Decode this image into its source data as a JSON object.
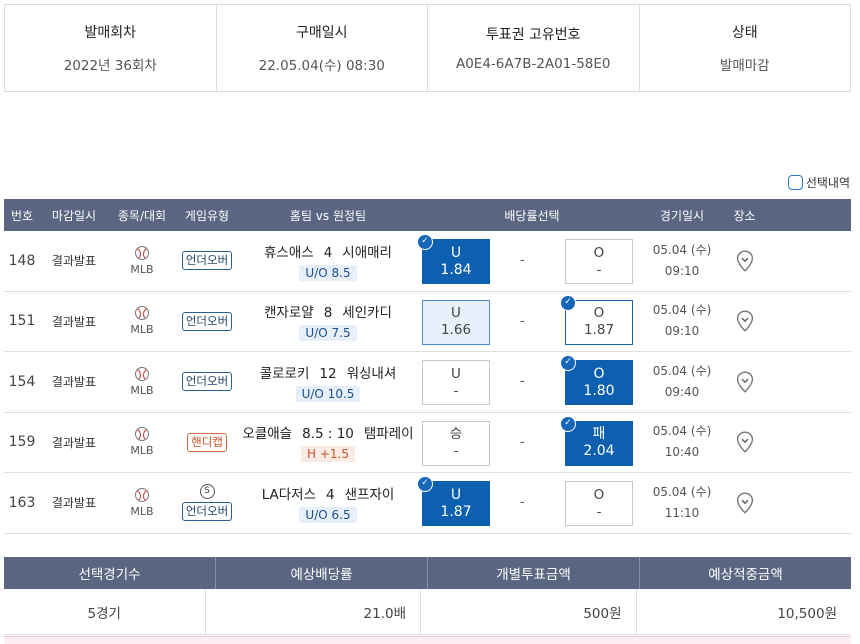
{
  "info": {
    "round_label": "발매회차",
    "round_value": "2022년 36회차",
    "purchase_label": "구매일시",
    "purchase_value": "22.05.04(수) 08:30",
    "ticket_label": "투표권 고유번호",
    "ticket_value": "A0E4-6A7B-2A01-58E0",
    "status_label": "상태",
    "status_value": "발매마감"
  },
  "selection_toggle": {
    "label": "선택내역"
  },
  "table_headers": {
    "no": "번호",
    "close": "마감일시",
    "sport": "종목/대회",
    "type": "게임유형",
    "match": "홈팀 vs 원정팀",
    "odds": "배당률선택",
    "date": "경기일시",
    "place": "장소"
  },
  "games": [
    {
      "no": "148",
      "close": "결과발표",
      "league": "MLB",
      "type": "언더오버",
      "type_color": "blue",
      "special": "",
      "home": "휴스애스",
      "score": "4",
      "away": "시애매리",
      "line": "U/O 8.5",
      "line_color": "blue",
      "left_label": "U",
      "left_odds": "1.84",
      "left_state": "sel",
      "left_check": true,
      "mid": "-",
      "right_label": "O",
      "right_odds": "-",
      "right_state": "",
      "right_check": false,
      "date": "05.04 (수)",
      "time": "09:10"
    },
    {
      "no": "151",
      "close": "결과발표",
      "league": "MLB",
      "type": "언더오버",
      "type_color": "blue",
      "special": "",
      "home": "캔자로얄",
      "score": "8",
      "away": "세인카디",
      "line": "U/O 7.5",
      "line_color": "blue",
      "left_label": "U",
      "left_odds": "1.66",
      "left_state": "light",
      "left_check": false,
      "mid": "-",
      "right_label": "O",
      "right_odds": "1.87",
      "right_state": "outline",
      "right_check": true,
      "date": "05.04 (수)",
      "time": "09:10"
    },
    {
      "no": "154",
      "close": "결과발표",
      "league": "MLB",
      "type": "언더오버",
      "type_color": "blue",
      "special": "",
      "home": "콜로로키",
      "score": "12",
      "away": "워싱내셔",
      "line": "U/O 10.5",
      "line_color": "blue",
      "left_label": "U",
      "left_odds": "-",
      "left_state": "",
      "left_check": false,
      "mid": "-",
      "right_label": "O",
      "right_odds": "1.80",
      "right_state": "sel",
      "right_check": true,
      "date": "05.04 (수)",
      "time": "09:40"
    },
    {
      "no": "159",
      "close": "결과발표",
      "league": "MLB",
      "type": "핸디캡",
      "type_color": "red",
      "special": "",
      "home": "오클애슬",
      "score": "8.5 : 10",
      "away": "탬파레이",
      "line": "H +1.5",
      "line_color": "red",
      "left_label": "승",
      "left_odds": "-",
      "left_state": "",
      "left_check": false,
      "mid": "-",
      "right_label": "패",
      "right_odds": "2.04",
      "right_state": "sel",
      "right_check": true,
      "date": "05.04 (수)",
      "time": "10:40"
    },
    {
      "no": "163",
      "close": "결과발표",
      "league": "MLB",
      "type": "언더오버",
      "type_color": "blue",
      "special": "S",
      "home": "LA다저스",
      "score": "4",
      "away": "샌프자이",
      "line": "U/O 6.5",
      "line_color": "blue",
      "left_label": "U",
      "left_odds": "1.87",
      "left_state": "sel",
      "left_check": true,
      "mid": "-",
      "right_label": "O",
      "right_odds": "-",
      "right_state": "",
      "right_check": false,
      "date": "05.04 (수)",
      "time": "11:10"
    }
  ],
  "totals": {
    "h_games": "선택경기수",
    "h_odds": "예상배당률",
    "h_amount": "개별투표금액",
    "h_payout": "예상적중금액",
    "games": "5경기",
    "odds": "21.0배",
    "amount": "500원",
    "payout": "10,500원"
  },
  "colors": {
    "header_bg": "#5a6581",
    "selected_blue": "#0d5fb0",
    "light_blue": "#e6f1fc"
  }
}
